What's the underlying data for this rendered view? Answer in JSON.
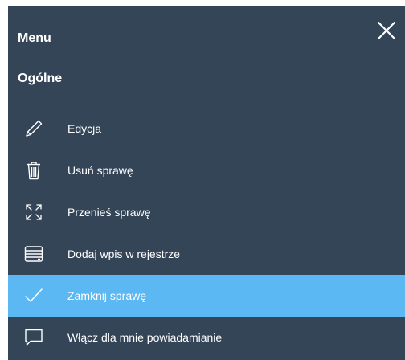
{
  "menu": {
    "title": "Menu",
    "close_icon": "close-icon",
    "section_title": "Ogólne",
    "items": [
      {
        "label": "Edycja",
        "icon": "pencil-icon",
        "active": false
      },
      {
        "label": "Usuń sprawę",
        "icon": "trash-icon",
        "active": false
      },
      {
        "label": "Przenieś sprawę",
        "icon": "move-arrows-icon",
        "active": false
      },
      {
        "label": "Dodaj wpis w rejestrze",
        "icon": "register-icon",
        "active": false
      },
      {
        "label": "Zamknij sprawę",
        "icon": "checkmark-icon",
        "active": true
      },
      {
        "label": "Włącz dla mnie powiadamianie",
        "icon": "chat-bubble-icon",
        "active": false
      }
    ]
  },
  "colors": {
    "panel_background": "#344558",
    "active_background": "#5cb8f2",
    "text": "#ffffff"
  }
}
